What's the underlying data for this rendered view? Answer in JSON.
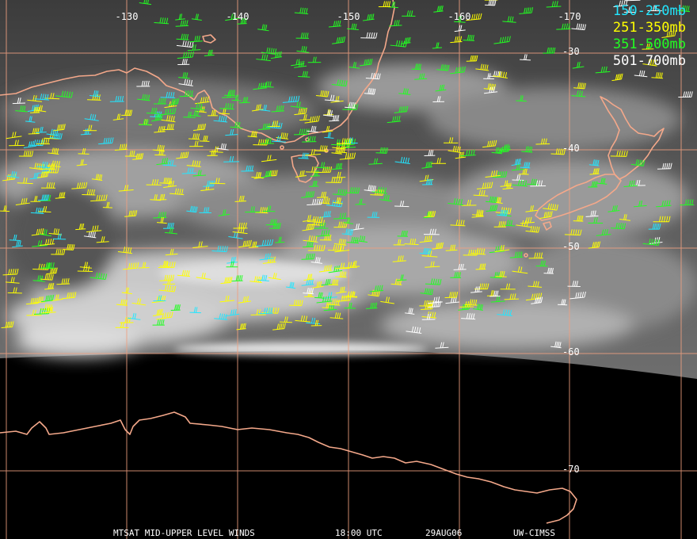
{
  "map": {
    "background_colors": {
      "cloud_bright": "#d8d8d8",
      "cloud_mid": "#8a8a8a",
      "cloud_dark": "#3a3a3a",
      "space": "#000000"
    },
    "grid_color": "#f0a080",
    "coastline_color": "#f4a88a",
    "longitude_labels": [
      "-130",
      "-140",
      "-150",
      "-160",
      "-170"
    ],
    "latitude_labels": [
      "-30",
      "-40",
      "-50",
      "-60",
      "-70"
    ]
  },
  "legend": {
    "items": [
      {
        "label": "150-250mb",
        "color": "#22e6ff"
      },
      {
        "label": "251-350mb",
        "color": "#ffff00"
      },
      {
        "label": "351-500mb",
        "color": "#22ff22"
      },
      {
        "label": "501-700mb",
        "color": "#ffffff"
      }
    ]
  },
  "footer": {
    "product": "MTSAT MID-UPPER LEVEL WINDS",
    "time": "18:00 UTC",
    "date": "29AUG06",
    "source": "UW-CIMSS"
  }
}
